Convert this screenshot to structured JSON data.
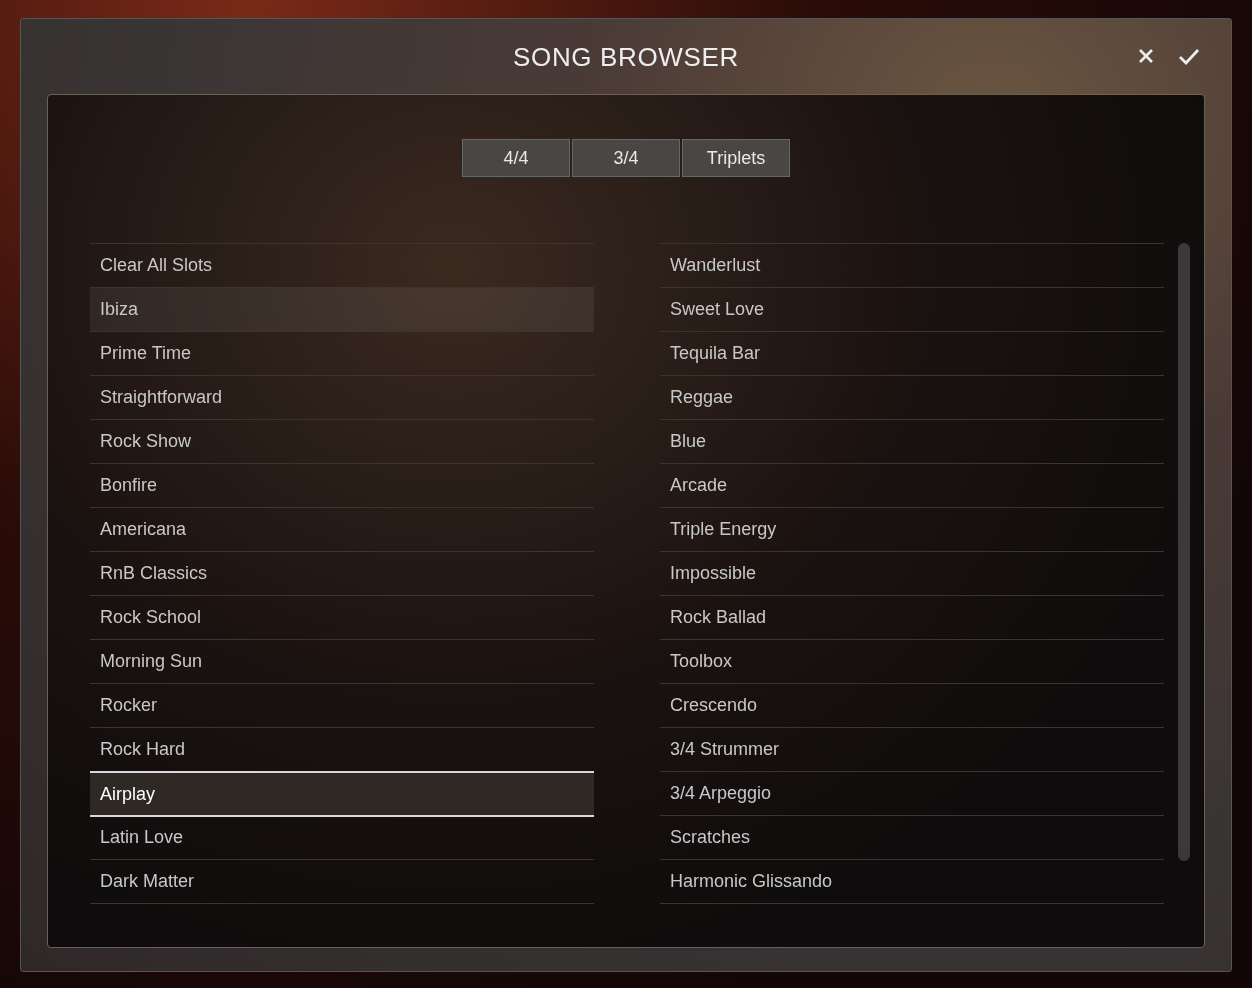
{
  "window": {
    "title": "SONG BROWSER"
  },
  "tabs": [
    {
      "label": "4/4"
    },
    {
      "label": "3/4"
    },
    {
      "label": "Triplets"
    }
  ],
  "left_list": [
    {
      "label": "Clear All Slots",
      "selected": false,
      "highlighted": false
    },
    {
      "label": "Ibiza",
      "selected": false,
      "highlighted": true
    },
    {
      "label": "Prime Time",
      "selected": false,
      "highlighted": false
    },
    {
      "label": "Straightforward",
      "selected": false,
      "highlighted": false
    },
    {
      "label": "Rock Show",
      "selected": false,
      "highlighted": false
    },
    {
      "label": "Bonfire",
      "selected": false,
      "highlighted": false
    },
    {
      "label": "Americana",
      "selected": false,
      "highlighted": false
    },
    {
      "label": "RnB Classics",
      "selected": false,
      "highlighted": false
    },
    {
      "label": "Rock School",
      "selected": false,
      "highlighted": false
    },
    {
      "label": "Morning Sun",
      "selected": false,
      "highlighted": false
    },
    {
      "label": "Rocker",
      "selected": false,
      "highlighted": false
    },
    {
      "label": "Rock Hard",
      "selected": false,
      "highlighted": false
    },
    {
      "label": "Airplay",
      "selected": true,
      "highlighted": false
    },
    {
      "label": "Latin Love",
      "selected": false,
      "highlighted": false
    },
    {
      "label": "Dark Matter",
      "selected": false,
      "highlighted": false
    }
  ],
  "right_list": [
    {
      "label": "Wanderlust",
      "selected": false,
      "highlighted": false
    },
    {
      "label": "Sweet Love",
      "selected": false,
      "highlighted": false
    },
    {
      "label": "Tequila Bar",
      "selected": false,
      "highlighted": false
    },
    {
      "label": "Reggae",
      "selected": false,
      "highlighted": false
    },
    {
      "label": "Blue",
      "selected": false,
      "highlighted": false
    },
    {
      "label": "Arcade",
      "selected": false,
      "highlighted": false
    },
    {
      "label": "Triple Energy",
      "selected": false,
      "highlighted": false
    },
    {
      "label": "Impossible",
      "selected": false,
      "highlighted": false
    },
    {
      "label": "Rock Ballad",
      "selected": false,
      "highlighted": false
    },
    {
      "label": "Toolbox",
      "selected": false,
      "highlighted": false
    },
    {
      "label": "Crescendo",
      "selected": false,
      "highlighted": false
    },
    {
      "label": "3/4 Strummer",
      "selected": false,
      "highlighted": false
    },
    {
      "label": "3/4 Arpeggio",
      "selected": false,
      "highlighted": false
    },
    {
      "label": "Scratches",
      "selected": false,
      "highlighted": false
    },
    {
      "label": "Harmonic Glissando",
      "selected": false,
      "highlighted": false
    }
  ]
}
